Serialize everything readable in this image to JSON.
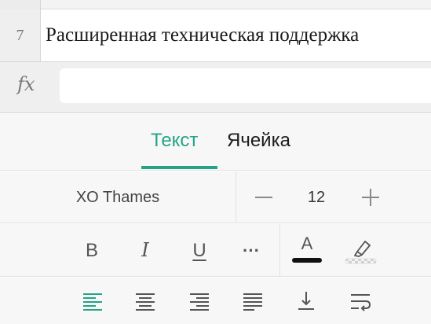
{
  "sheet": {
    "row_number": "7",
    "cell_text": "Расширенная техническая поддержка"
  },
  "formula_bar": {
    "fx_label": "fx",
    "value": ""
  },
  "tabs": {
    "text_label": "Текст",
    "cell_label": "Ячейка",
    "active": "text"
  },
  "font": {
    "name": "XO Thames",
    "size": "12"
  },
  "style_buttons": {
    "bold": "B",
    "italic": "I",
    "underline": "U",
    "more": "···",
    "text_color_letter": "A",
    "text_color": "#111111"
  },
  "colors": {
    "accent": "#23a487",
    "icon": "#555555",
    "panel_bg": "#f7f7f7"
  },
  "align_icons": [
    "align-left-icon",
    "align-center-icon",
    "align-right-icon",
    "align-justify-icon",
    "vertical-align-bottom-icon",
    "wrap-text-icon"
  ]
}
